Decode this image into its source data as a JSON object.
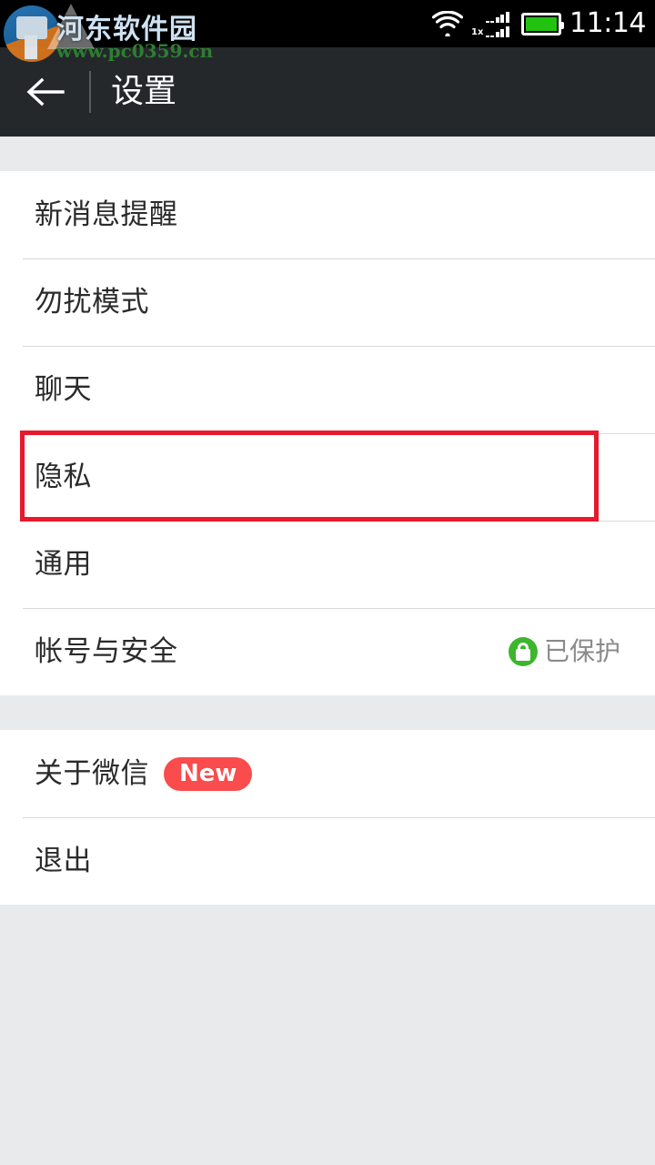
{
  "status_bar": {
    "time": "11:14",
    "icons": {
      "wifi": "wifi-icon",
      "signal_label": "1x",
      "battery": "battery-icon"
    }
  },
  "watermark": {
    "title": "河东软件园",
    "url": "www.pc0359.cn",
    "logo": "site-logo-icon"
  },
  "nav": {
    "back_icon": "back-arrow-icon",
    "title": "设置"
  },
  "sections": [
    {
      "rows": [
        {
          "label": "新消息提醒",
          "value": "",
          "badge": ""
        },
        {
          "label": "勿扰模式",
          "value": "",
          "badge": ""
        },
        {
          "label": "聊天",
          "value": "",
          "badge": ""
        },
        {
          "label": "隐私",
          "value": "",
          "badge": "",
          "highlighted": true
        },
        {
          "label": "通用",
          "value": "",
          "badge": ""
        },
        {
          "label": "帐号与安全",
          "value": "已保护",
          "badge": "",
          "icon": "lock-icon"
        }
      ]
    },
    {
      "rows": [
        {
          "label": "关于微信",
          "value": "",
          "badge": "New"
        },
        {
          "label": "退出",
          "value": "",
          "badge": ""
        }
      ]
    }
  ],
  "colors": {
    "nav_bar": "#24282b",
    "status_bar": "#000000",
    "page_background": "#e9eaeb",
    "row_background": "#ffffff",
    "divider": "#d9d9d9",
    "label_text": "#2b2b2b",
    "value_text": "#8a8a8a",
    "annotation_red": "#e8192c",
    "badge_red": "#fa4c4c",
    "lock_green": "#3cb62c",
    "battery_green": "#22c211",
    "watermark_green": "#2e7d32"
  }
}
